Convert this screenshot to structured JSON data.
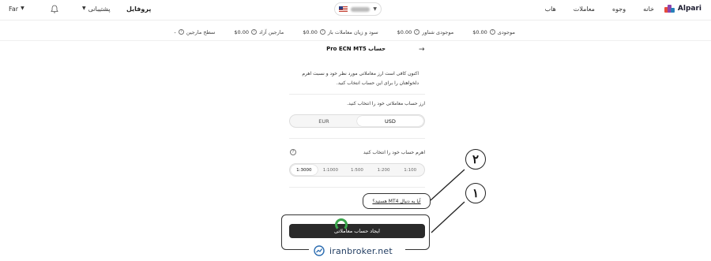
{
  "header": {
    "logo_text": "Alpari",
    "nav": [
      "خانه",
      "وجوه",
      "معاملات",
      "هاب"
    ],
    "profile": "پروفایل",
    "support": "پشتیبانی",
    "lang": "Far"
  },
  "balance": [
    {
      "label": "موجودی",
      "value": "$0.00"
    },
    {
      "label": "موجودی شناور",
      "value": "$0.00"
    },
    {
      "label": "سود و زیان معاملات باز",
      "value": "$0.00"
    },
    {
      "label": "مارجین آزاد",
      "value": "$0.00"
    },
    {
      "label": "سطح مارجین",
      "value": "-"
    }
  ],
  "form": {
    "title": "حساب Pro ECN MT5",
    "description": "اکنون کافی است ارز معاملاتی مورد نظر خود و نسبت اهرم دلخواهتان را برای این حساب انتخاب کنید.",
    "currency_label": "ارز حساب معاملاتی خود را انتخاب کنید.",
    "currencies": [
      "EUR",
      "USD"
    ],
    "currency_selected": "USD",
    "leverage_label": "اهرم حساب خود را انتخاب کنید",
    "leverages": [
      "1:3000",
      "1:1000",
      "1:500",
      "1:200",
      "1:100"
    ],
    "leverage_selected": "1:3000",
    "mt4_link": "آیا به دنبال MT4 هستید؟",
    "create_button": "ایجاد حساب معاملاتی"
  },
  "annotations": [
    "۱",
    "۲"
  ],
  "watermark": "iranbroker.net",
  "colors": {
    "accent": "#2a2a2a",
    "cursor": "#3aa54b"
  }
}
